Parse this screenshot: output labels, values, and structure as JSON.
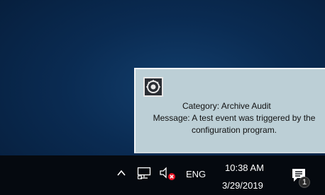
{
  "notification": {
    "icon": "alarm-bell-icon",
    "category": "Category: Archive Audit",
    "message": "Message: A test event was triggered by the configuration program."
  },
  "taskbar": {
    "tray": {
      "show_hidden_icon": "chevron-up-icon",
      "network_icon": "network-icon",
      "volume_icon": "volume-muted-icon",
      "language": "ENG"
    },
    "clock": {
      "time": "10:38 AM",
      "date": "3/29/2019"
    },
    "action_center": {
      "icon": "action-center-icon",
      "badge": "1"
    }
  }
}
